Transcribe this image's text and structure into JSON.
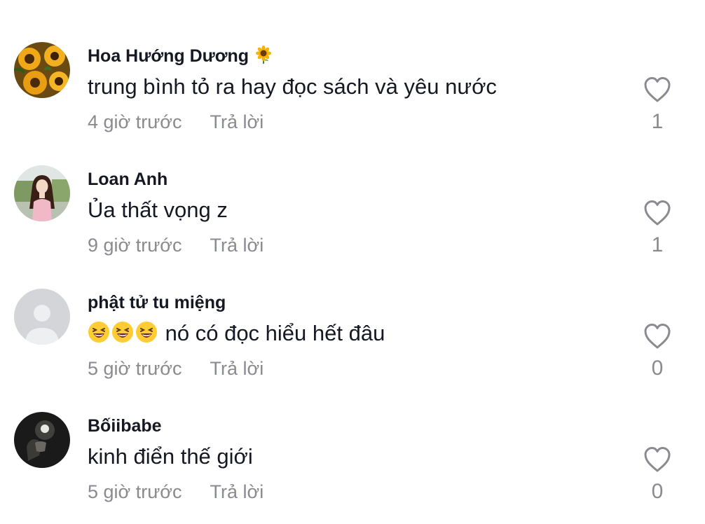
{
  "comments": [
    {
      "username": "Hoa Hướng Dương",
      "badge": "sunflower-emoji",
      "text": "trung bình tỏ ra hay đọc sách và yêu nước",
      "time": "4 giờ trước",
      "reply": "Trả lời",
      "likes": "1"
    },
    {
      "username": "Loan Anh",
      "text": "Ủa thất vọng z",
      "time": "9 giờ trước",
      "reply": "Trả lời",
      "likes": "1"
    },
    {
      "username": "phật tử tu miệng",
      "emojis": [
        "laughing-emoji",
        "laughing-emoji",
        "laughing-emoji"
      ],
      "text": "nó có đọc hiểu hết đâu",
      "time": "5 giờ trước",
      "reply": "Trả lời",
      "likes": "0"
    },
    {
      "username": "Bốiibabe",
      "text": "kinh điển thế giới",
      "time": "5 giờ trước",
      "reply": "Trả lời",
      "likes": "0"
    }
  ],
  "colors": {
    "text_primary": "#161823",
    "text_secondary": "#8a8b91",
    "icon_stroke": "#8a8b91",
    "background": "#ffffff"
  }
}
